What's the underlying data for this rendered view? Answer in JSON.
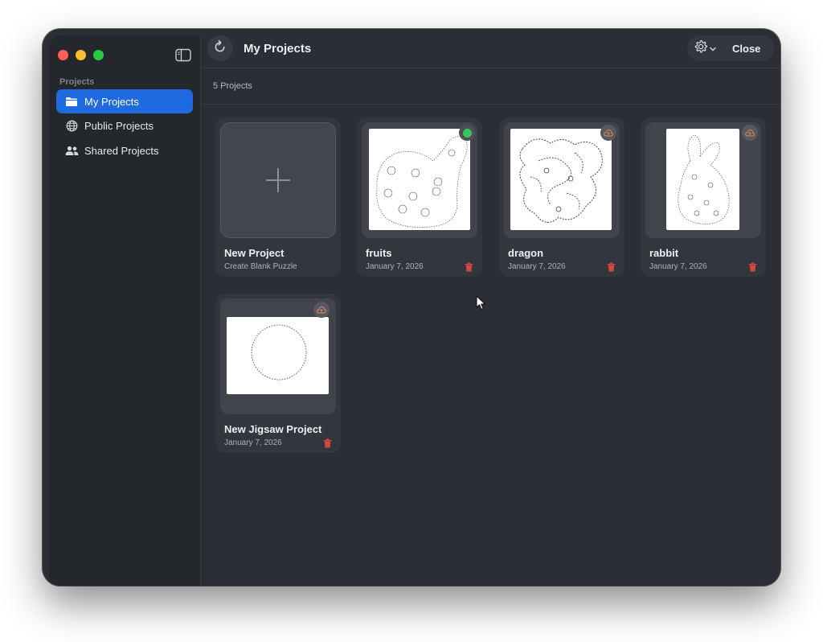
{
  "sidebar": {
    "section_label": "Projects",
    "items": [
      {
        "label": "My Projects",
        "icon": "folder-icon",
        "active": true
      },
      {
        "label": "Public Projects",
        "icon": "globe-icon",
        "active": false
      },
      {
        "label": "Shared Projects",
        "icon": "people-icon",
        "active": false
      }
    ]
  },
  "toolbar": {
    "title": "My Projects",
    "close_label": "Close"
  },
  "projects_header": {
    "count_text": "5 Projects"
  },
  "new_project": {
    "title": "New Project",
    "subtitle": "Create Blank Puzzle"
  },
  "projects": [
    {
      "name": "fruits",
      "date": "January 7, 2026",
      "sync_status": "synced",
      "status_icon": "sync-done-icon"
    },
    {
      "name": "dragon",
      "date": "January 7, 2026",
      "sync_status": "upload",
      "status_icon": "cloud-upload-icon"
    },
    {
      "name": "rabbit",
      "date": "January 7, 2026",
      "sync_status": "upload",
      "status_icon": "cloud-upload-icon"
    },
    {
      "name": "New Jigsaw Project",
      "date": "January 7, 2026",
      "sync_status": "upload",
      "status_icon": "cloud-upload-icon"
    }
  ],
  "colors": {
    "accent": "#1f6ae0",
    "window_bg": "#2b2e34",
    "sidebar_bg": "#24272c",
    "delete": "#d9463e",
    "synced": "#35c759",
    "upload": "#e8894a"
  }
}
